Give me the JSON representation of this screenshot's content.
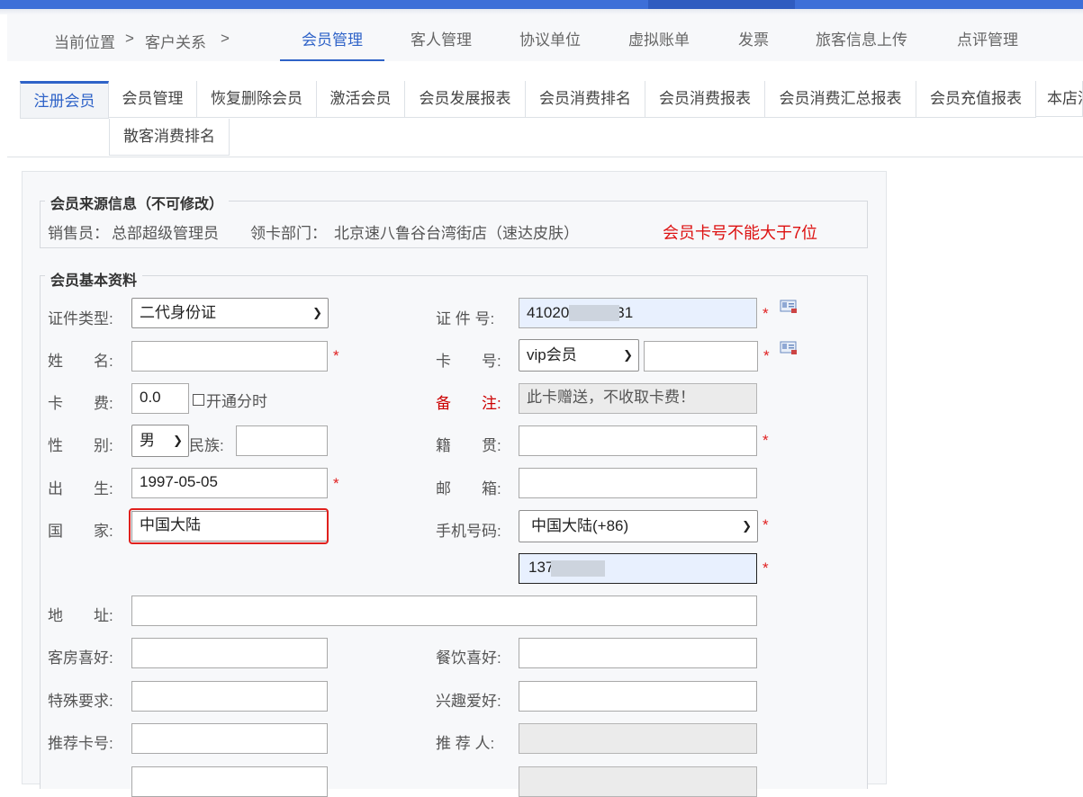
{
  "breadcrumb": {
    "current_label": "当前位置",
    "sep1": ">",
    "section": "客户关系",
    "sep2": ">"
  },
  "nav": [
    {
      "label": "会员管理",
      "active": true
    },
    {
      "label": "客人管理"
    },
    {
      "label": "协议单位"
    },
    {
      "label": "虚拟账单"
    },
    {
      "label": "发票"
    },
    {
      "label": "旅客信息上传"
    },
    {
      "label": "点评管理"
    }
  ],
  "subtabs": [
    {
      "label": "注册会员",
      "active": true
    },
    {
      "label": "会员管理"
    },
    {
      "label": "恢复删除会员"
    },
    {
      "label": "激活会员"
    },
    {
      "label": "会员发展报表"
    },
    {
      "label": "会员消费排名"
    },
    {
      "label": "会员消费报表"
    },
    {
      "label": "会员消费汇总报表"
    },
    {
      "label": "会员充值报表"
    },
    {
      "label": "本店消"
    },
    {
      "label": "散客消费排名"
    }
  ],
  "source": {
    "legend": "会员来源信息（不可修改）",
    "seller_label": "销售员：",
    "seller": "总部超级管理员",
    "dept_label": "领卡部门：",
    "dept": "北京速八鲁谷台湾街店（速达皮肤）",
    "warning": "会员卡号不能大于7位"
  },
  "basic": {
    "legend": "会员基本资料",
    "id_type_label": "证件类型:",
    "id_type": "二代身份证",
    "id_no_label": "证 件 号:",
    "id_no": "41020        5056531",
    "name_label": "姓　　名:",
    "name": "",
    "card_no_label": "卡　　号:",
    "card_type": "vip会员",
    "card_no": "",
    "fee_label": "卡　　费:",
    "fee": "0.0",
    "points_label": "开通分时",
    "remark_label": "备　　注:",
    "remark": "此卡赠送，不收取卡费！",
    "gender_label": "性　　别:",
    "gender": "男",
    "ethnic_label": "民族:",
    "ethnic": "",
    "native_label": "籍　　贯:",
    "native": "",
    "birth_label": "出　　生:",
    "birth": "1997-05-05",
    "email_label": "邮　　箱:",
    "email": "",
    "country_label": "国　　家:",
    "country": "中国大陆",
    "phone_label": "手机号码:",
    "phone_region": "中国大陆(+86)",
    "phone": "137        085",
    "address_label": "地　　址:",
    "address": "",
    "room_pref_label": "客房喜好:",
    "room_pref": "",
    "food_pref_label": "餐饮喜好:",
    "food_pref": "",
    "special_label": "特殊要求:",
    "special": "",
    "hobby_label": "兴趣爱好:",
    "hobby": "",
    "ref_card_label": "推荐卡号:",
    "ref_card": "",
    "referrer_label": "推 荐 人:",
    "referrer": "",
    "required_mark": "*"
  },
  "colors": {
    "accent": "#2f63c8",
    "required": "#e02020",
    "highlight": "#e0201d"
  }
}
